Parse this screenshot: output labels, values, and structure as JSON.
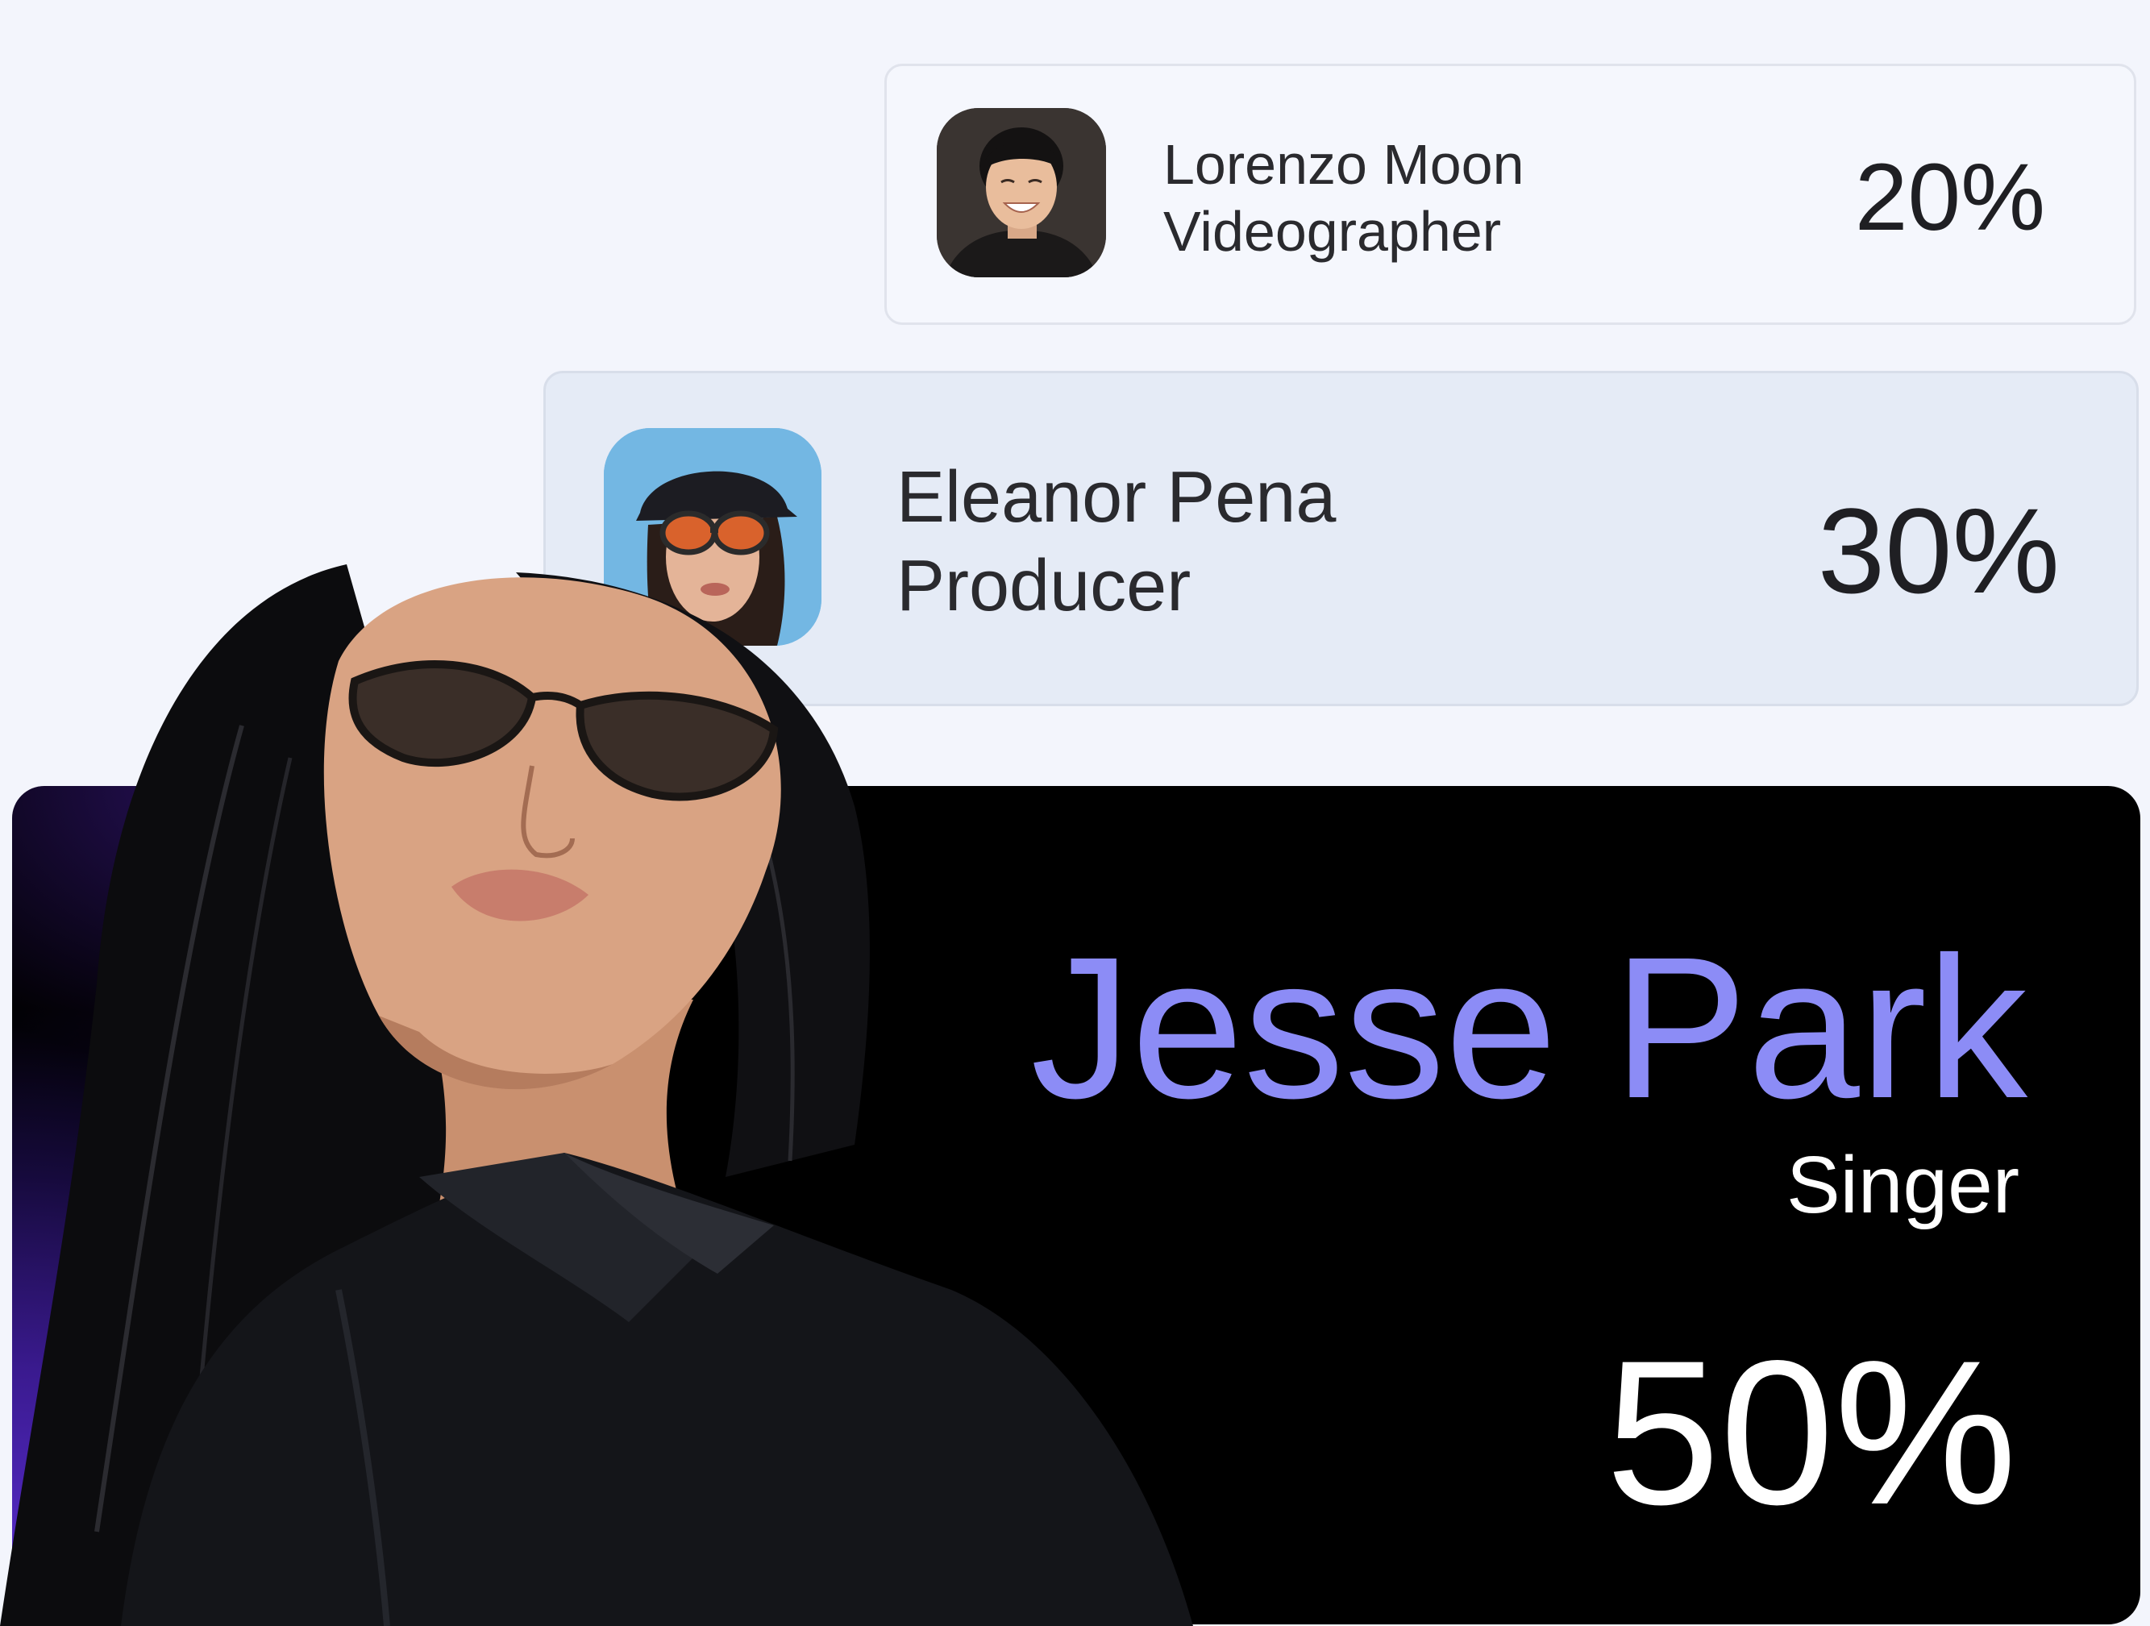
{
  "collaborators": [
    {
      "name": "Lorenzo Moon",
      "role": "Videographer",
      "share": "20%",
      "avatar_icon": "person-avatar-icon"
    },
    {
      "name": "Eleanor Pena",
      "role": "Producer",
      "share": "30%",
      "avatar_icon": "person-avatar-icon"
    }
  ],
  "featured": {
    "name": "Jesse Park",
    "role": "Singer",
    "share": "50%",
    "photo_icon": "portrait-photo"
  },
  "colors": {
    "page_background": "#f3f5fc",
    "featured_name": "#8c8cf6",
    "featured_background": "#000000",
    "featured_glow": "#5d2fd8",
    "highlighted_card": "#e5ebf6"
  }
}
